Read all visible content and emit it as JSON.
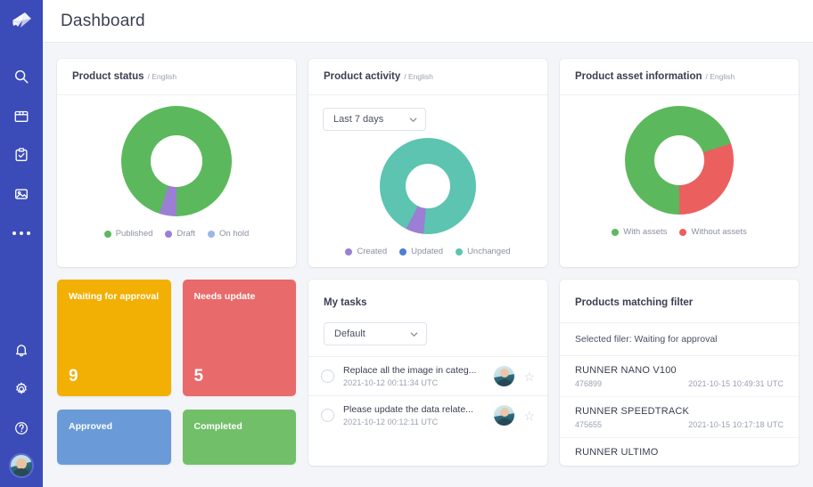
{
  "app": {
    "logo_icon": "origami-logo-icon",
    "accent": "#3b4cb8"
  },
  "sidebar": {
    "top_items": [
      {
        "icon": "search-icon",
        "name": "search"
      },
      {
        "icon": "box-icon",
        "name": "products"
      },
      {
        "icon": "clipboard-check-icon",
        "name": "tasks"
      },
      {
        "icon": "image-icon",
        "name": "assets"
      },
      {
        "icon": "more-horizontal-icon",
        "name": "more"
      }
    ],
    "bottom_items": [
      {
        "icon": "bell-icon",
        "name": "notifications"
      },
      {
        "icon": "gear-icon",
        "name": "settings"
      },
      {
        "icon": "help-circle-icon",
        "name": "help"
      },
      {
        "icon": "avatar",
        "name": "user-profile"
      }
    ]
  },
  "header": {
    "title": "Dashboard"
  },
  "cards": {
    "product_status": {
      "title": "Product status",
      "lang": "/ English"
    },
    "product_activity": {
      "title": "Product activity",
      "lang": "/ English",
      "range_select": {
        "value": "Last 7 days",
        "chevron": "chevron-down-icon"
      }
    },
    "product_asset_information": {
      "title": "Product asset information",
      "lang": "/ English"
    },
    "my_tasks": {
      "title": "My tasks",
      "sort_select": {
        "value": "Default",
        "chevron": "chevron-down-icon"
      },
      "rows": [
        {
          "title": "Replace all the image in categ...",
          "date": "2021-10-12  00:11:34 UTC",
          "star": "star-outline-icon"
        },
        {
          "title": "Please update the data relate...",
          "date": "2021-10-12  00:12:11 UTC",
          "star": "star-outline-icon"
        }
      ]
    },
    "products_matching_filter": {
      "title": "Products matching filter",
      "filter_text": "Selected filer: Waiting for approval",
      "rows": [
        {
          "name": "RUNNER NANO V100",
          "id": "476899",
          "date": "2021-10-15  10:49:31 UTC"
        },
        {
          "name": "RUNNER SPEEDTRACK",
          "id": "475655",
          "date": "2021-10-15  10:17:18 UTC"
        },
        {
          "name": "RUNNER ULTIMO",
          "id": "",
          "date": ""
        }
      ]
    }
  },
  "tiles": [
    {
      "label": "Waiting for approval",
      "value": "9",
      "color": "#f2b005"
    },
    {
      "label": "Needs update",
      "value": "5",
      "color": "#e96a6a"
    },
    {
      "label": "Approved",
      "value": "",
      "color": "#6a9bd8"
    },
    {
      "label": "Completed",
      "value": "",
      "color": "#72bf6a"
    }
  ],
  "chart_data": [
    {
      "type": "pie",
      "title": "Product status",
      "subtitle": "/ English",
      "legend_position": "bottom",
      "categories": [
        "Published",
        "Draft",
        "On hold"
      ],
      "values": [
        95,
        5,
        0
      ],
      "colors": [
        "#5cb85c",
        "#9b7fd4",
        "#9cb6e8"
      ],
      "donut": true
    },
    {
      "type": "pie",
      "title": "Product activity",
      "subtitle": "/ English",
      "legend_position": "bottom",
      "categories": [
        "Created",
        "Updated",
        "Unchanged"
      ],
      "values": [
        6,
        0,
        94
      ],
      "colors": [
        "#9b7fd4",
        "#4a7fd4",
        "#5cc4b0"
      ],
      "donut": true
    },
    {
      "type": "pie",
      "title": "Product asset information",
      "subtitle": "/ English",
      "legend_position": "bottom",
      "categories": [
        "With assets",
        "Without assets"
      ],
      "values": [
        70,
        30
      ],
      "colors": [
        "#5cb85c",
        "#eb5f5f"
      ],
      "donut": true
    }
  ]
}
